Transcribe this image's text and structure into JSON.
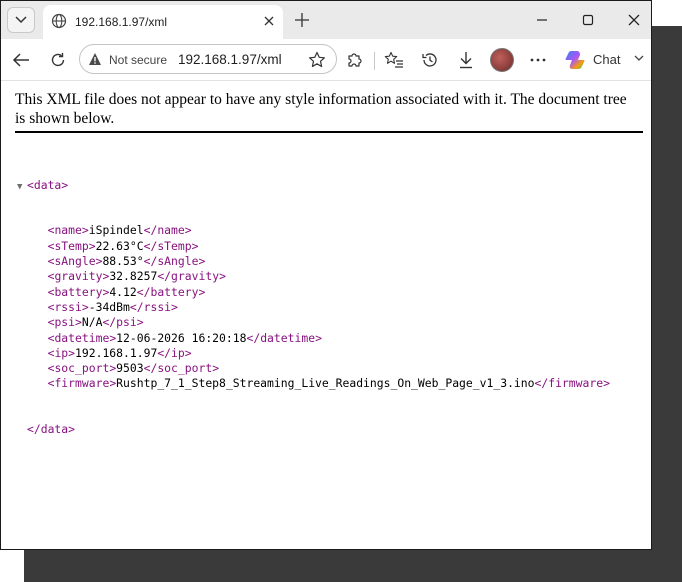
{
  "browser": {
    "tab": {
      "title": "192.168.1.97/xml",
      "favicon": "globe-icon"
    },
    "address_bar": {
      "security_label": "Not secure",
      "url": "192.168.1.97/xml"
    },
    "chat_label": "Chat",
    "accent_colors": {
      "chat_logo": [
        "#3b82f6",
        "#a855f7",
        "#f59e0b",
        "#22c55e"
      ]
    }
  },
  "notice": "This XML file does not appear to have any style information associated with it. The document tree is shown below.",
  "xml": {
    "root_tag": "data",
    "elements": [
      {
        "tag": "name",
        "value": "iSpindel"
      },
      {
        "tag": "sTemp",
        "value": "22.63°C"
      },
      {
        "tag": "sAngle",
        "value": "88.53°"
      },
      {
        "tag": "gravity",
        "value": "32.8257"
      },
      {
        "tag": "battery",
        "value": "4.12"
      },
      {
        "tag": "rssi",
        "value": "-34dBm"
      },
      {
        "tag": "psi",
        "value": "N/A"
      },
      {
        "tag": "datetime",
        "value": "12-06-2026 16:20:18"
      },
      {
        "tag": "ip",
        "value": "192.168.1.97"
      },
      {
        "tag": "soc_port",
        "value": "9503"
      },
      {
        "tag": "firmware",
        "value": "Rushtp_7_1_Step8_Streaming_Live_Readings_On_Web_Page_v1_3.ino"
      }
    ],
    "tag_color": "#881280"
  }
}
